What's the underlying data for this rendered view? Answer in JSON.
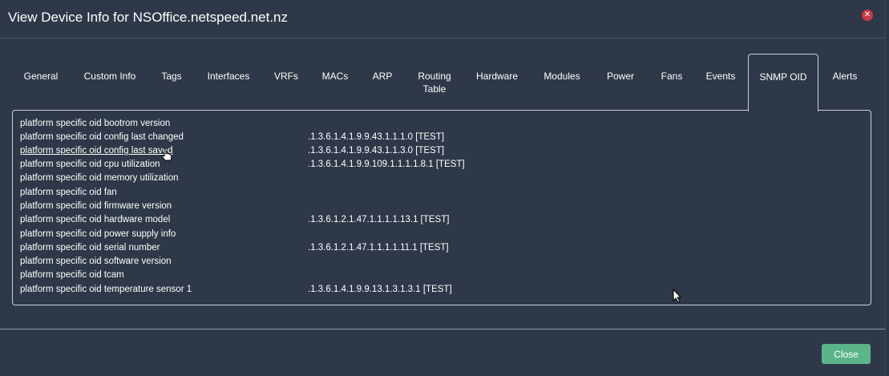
{
  "modal": {
    "title": "View Device Info for NSOffice.netspeed.net.nz",
    "close_icon": "close-icon",
    "close_button": "Close"
  },
  "tabs": [
    {
      "label": "General",
      "active": false
    },
    {
      "label": "Custom Info",
      "active": false
    },
    {
      "label": "Tags",
      "active": false
    },
    {
      "label": "Interfaces",
      "active": false
    },
    {
      "label": "VRFs",
      "active": false
    },
    {
      "label": "MACs",
      "active": false
    },
    {
      "label": "ARP",
      "active": false
    },
    {
      "label": "Routing Table",
      "active": false
    },
    {
      "label": "Hardware",
      "active": false
    },
    {
      "label": "Modules",
      "active": false
    },
    {
      "label": "Power",
      "active": false
    },
    {
      "label": "Fans",
      "active": false
    },
    {
      "label": "Events",
      "active": false
    },
    {
      "label": "SNMP OID",
      "active": true
    },
    {
      "label": "Alerts",
      "active": false
    }
  ],
  "oids": [
    {
      "name": "platform specific oid bootrom version",
      "value": ""
    },
    {
      "name": "platform specific oid config last changed",
      "value": ".1.3.6.1.4.1.9.9.43.1.1.1.0  [TEST]"
    },
    {
      "name": "platform specific oid config last saved",
      "value": ".1.3.6.1.4.1.9.9.43.1.1.3.0  [TEST]",
      "hovered": true
    },
    {
      "name": "platform specific oid cpu utilization",
      "value": ".1.3.6.1.4.1.9.9.109.1.1.1.1.8.1  [TEST]"
    },
    {
      "name": "platform specific oid memory utilization",
      "value": ""
    },
    {
      "name": "platform specific oid fan",
      "value": ""
    },
    {
      "name": "platform specific oid firmware version",
      "value": ""
    },
    {
      "name": "platform specific oid hardware model",
      "value": ".1.3.6.1.2.1.47.1.1.1.1.13.1  [TEST]"
    },
    {
      "name": "platform specific oid power supply info",
      "value": ""
    },
    {
      "name": "platform specific oid serial number",
      "value": ".1.3.6.1.2.1.47.1.1.1.1.11.1  [TEST]"
    },
    {
      "name": "platform specific oid software version",
      "value": ""
    },
    {
      "name": "platform specific oid tcam",
      "value": ""
    },
    {
      "name": "platform specific oid temperature sensor 1",
      "value": ".1.3.6.1.4.1.9.9.13.1.3.1.3.1  [TEST]"
    }
  ],
  "colors": {
    "background": "#2e3848",
    "accent_close": "#5cb58a",
    "close_x": "#c9394a"
  }
}
